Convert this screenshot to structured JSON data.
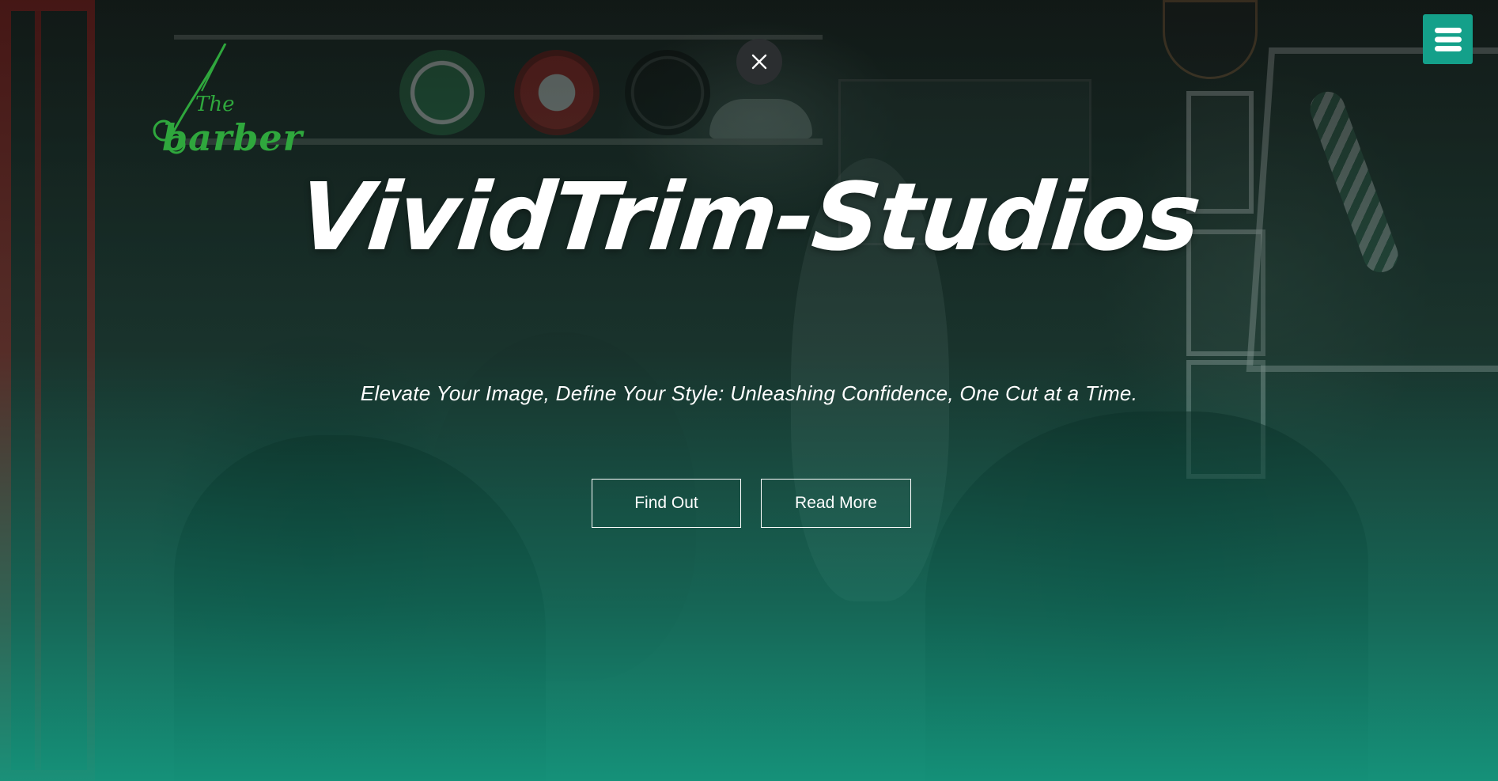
{
  "brand": {
    "logo_small": "The",
    "logo_large": "barber"
  },
  "hero": {
    "title": "VividTrim-Studios",
    "tagline": "Elevate Your Image, Define Your Style: Unleashing Confidence, One Cut at a Time.",
    "buttons": [
      {
        "label": "Find Out"
      },
      {
        "label": "Read More"
      }
    ]
  },
  "controls": {
    "close_icon": "close-icon",
    "menu_icon": "hamburger-menu-icon"
  },
  "colors": {
    "accent": "#14a08a",
    "logo_green": "#2fa73d",
    "text": "#ffffff",
    "close_bg": "#2b2e30"
  }
}
